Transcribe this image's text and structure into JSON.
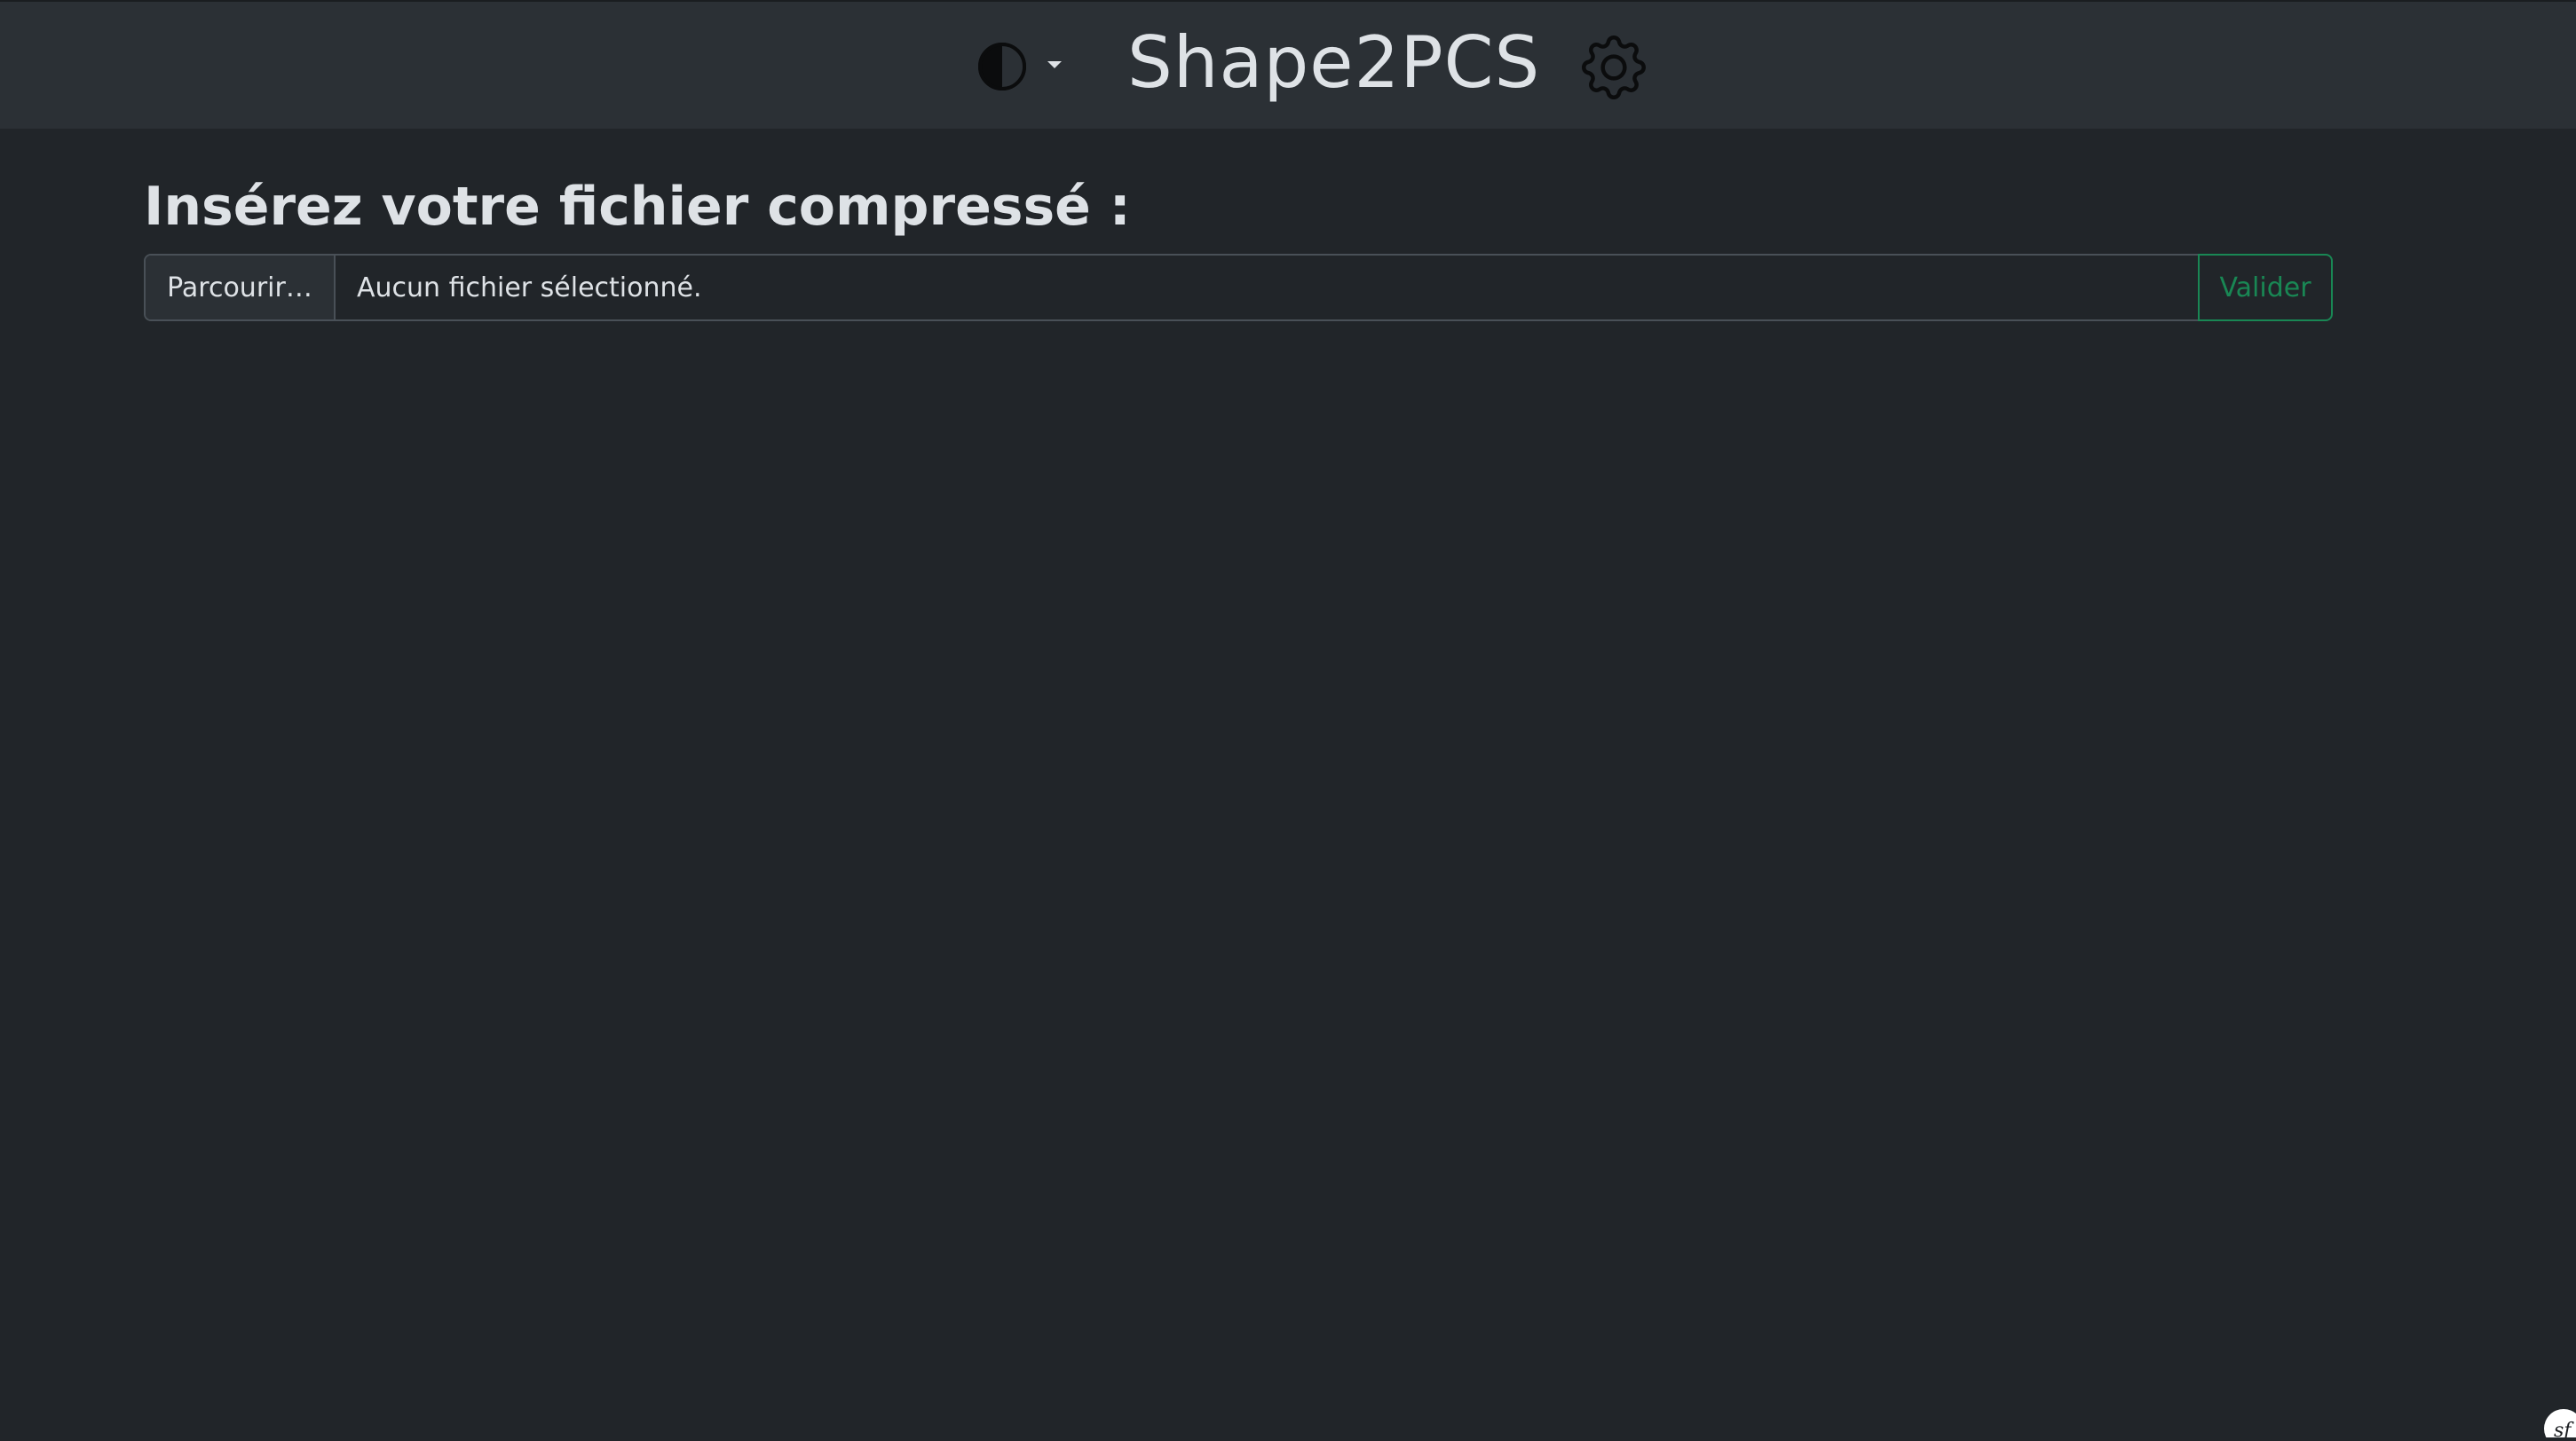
{
  "header": {
    "title": "Shape2PCS",
    "theme_toggle_icon": "contrast-circle-icon",
    "dropdown_icon": "caret-down-icon",
    "settings_icon": "gear-icon"
  },
  "main": {
    "heading": "Insérez votre fichier compressé :",
    "file_input": {
      "browse_label": "Parcourir…",
      "status_text": "Aucun fichier sélectionné."
    },
    "submit_label": "Valider"
  },
  "footer": {
    "toolbar_icon": "symfony-logo-icon"
  },
  "colors": {
    "background": "#212529",
    "navbar": "#2b3035",
    "text": "#dee2e6",
    "success": "#198754",
    "border": "#495057"
  }
}
